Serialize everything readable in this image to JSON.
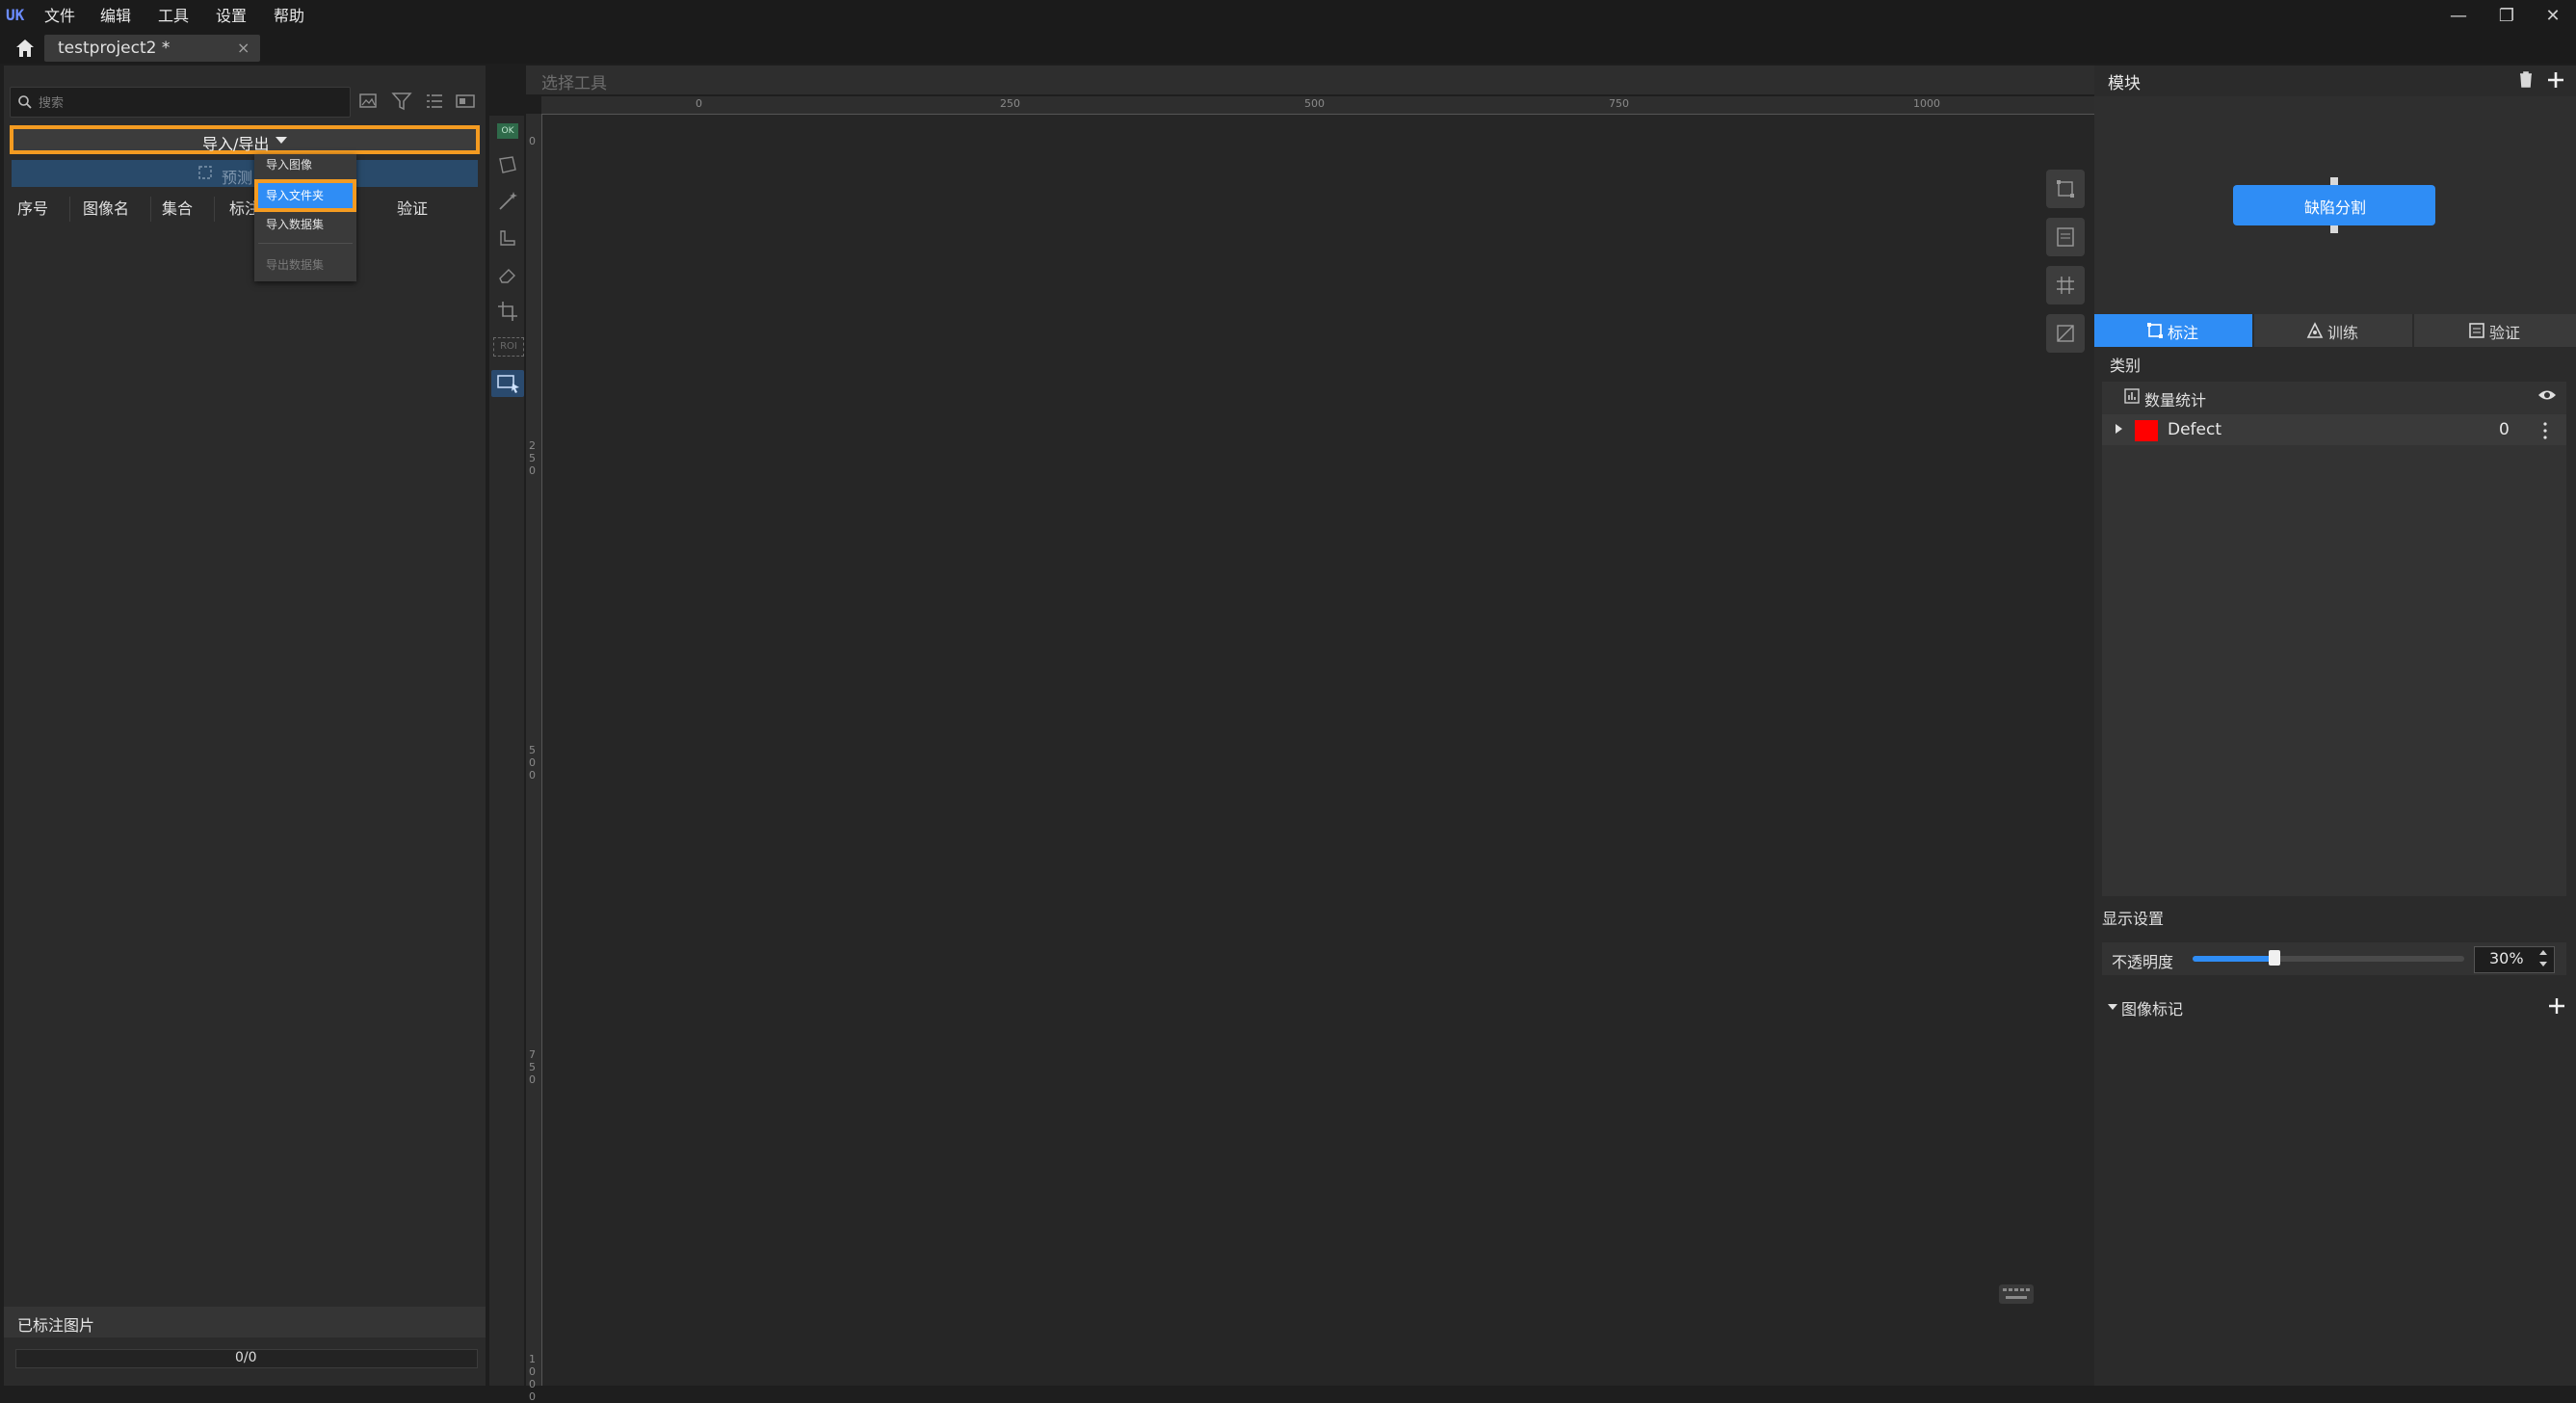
{
  "app": {
    "logo_text": "UK",
    "menu": [
      "文件",
      "编辑",
      "工具",
      "设置",
      "帮助"
    ],
    "window_controls": [
      "—",
      "❐",
      "✕"
    ]
  },
  "tabs": [
    {
      "label": "testproject2 *",
      "close": "×"
    }
  ],
  "left_panel": {
    "search_placeholder": "搜索",
    "import_export_label": "导入/导出",
    "predict_label": "预测",
    "columns": [
      "序号",
      "图像名",
      "集合",
      "标注",
      "验证"
    ],
    "dropdown": [
      "导入图像",
      "导入文件夹",
      "导入数据集",
      "导出数据集"
    ],
    "labeled_title": "已标注图片",
    "labeled_progress_text": "0/0",
    "labeled_progress": 0
  },
  "canvas": {
    "tool_title": "选择工具",
    "ruler_top": [
      "0",
      "250",
      "500",
      "750",
      "1000"
    ],
    "ruler_left": [
      "0",
      "250",
      "500",
      "750",
      "1000"
    ]
  },
  "right_panel": {
    "module_title": "模块",
    "module_node": "缺陷分割",
    "tabs": [
      "标注",
      "训练",
      "验证"
    ],
    "active_tab": "标注",
    "category_title": "类别",
    "stat_label": "数量统计",
    "classes": [
      {
        "name": "Defect",
        "count": "0",
        "color": "#ff0000"
      }
    ],
    "display_title": "显示设置",
    "opacity_label": "不透明度",
    "opacity_value": "30%",
    "opacity": 0.3,
    "image_marks_label": "图像标记"
  },
  "colors": {
    "accent": "#2f8df5",
    "highlight": "#f49b21"
  }
}
